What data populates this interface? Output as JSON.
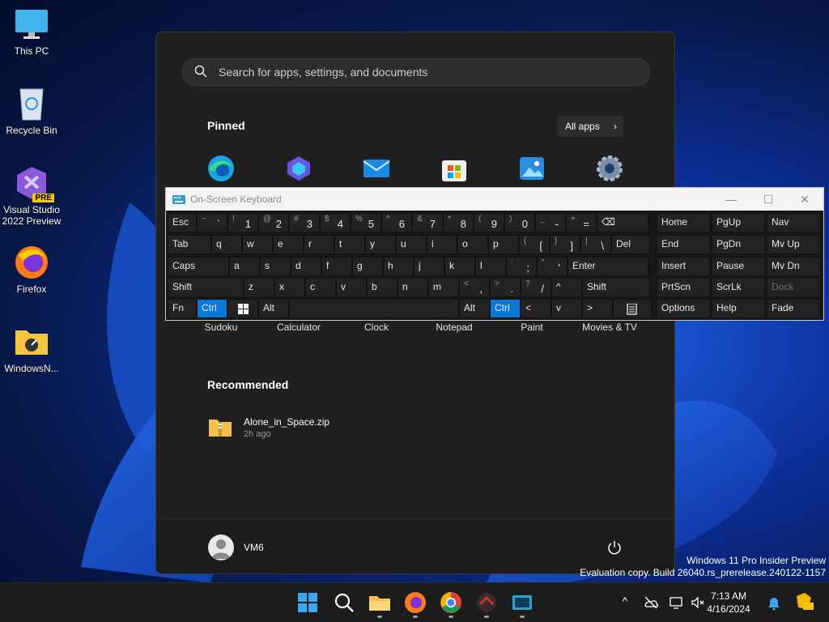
{
  "desktop": {
    "icons": [
      {
        "label": "This PC"
      },
      {
        "label": "Recycle Bin"
      },
      {
        "label": "Visual Studio 2022 Preview",
        "badge": "PRE"
      },
      {
        "label": "Firefox"
      },
      {
        "label": "WindowsN..."
      }
    ],
    "watermark": {
      "line1": "Windows 11 Pro Insider Preview",
      "line2": "Evaluation copy. Build 26040.rs_prerelease.240122-1157"
    }
  },
  "start_menu": {
    "search_placeholder": "Search for apps, settings, and documents",
    "pinned_title": "Pinned",
    "all_apps_label": "All apps",
    "all_apps_chevron": "›",
    "pinned_apps": [
      {
        "label": "",
        "icon": "edge-icon"
      },
      {
        "label": "",
        "icon": "copilot-icon"
      },
      {
        "label": "",
        "icon": "mail-icon"
      },
      {
        "label": "",
        "icon": "store-icon"
      },
      {
        "label": "",
        "icon": "photos-icon"
      },
      {
        "label": "",
        "icon": "settings-icon"
      },
      {
        "label": "Sudoku"
      },
      {
        "label": "Calculator"
      },
      {
        "label": "Clock"
      },
      {
        "label": "Notepad"
      },
      {
        "label": "Paint"
      },
      {
        "label": "Movies & TV"
      }
    ],
    "recommended_title": "Recommended",
    "recommended": [
      {
        "name": "Alone_in_Space.zip",
        "time": "2h ago"
      }
    ],
    "user": {
      "name": "VM6"
    }
  },
  "osk": {
    "title": "On-Screen Keyboard",
    "window_buttons": {
      "minimize": "—",
      "maximize": "☐",
      "close": "✕"
    },
    "rows": {
      "r1": [
        {
          "main": "Esc"
        },
        {
          "shift": "~",
          "main": "`"
        },
        {
          "shift": "!",
          "main": "1"
        },
        {
          "shift": "@",
          "main": "2"
        },
        {
          "shift": "#",
          "main": "3"
        },
        {
          "shift": "$",
          "main": "4"
        },
        {
          "shift": "%",
          "main": "5"
        },
        {
          "shift": "^",
          "main": "6"
        },
        {
          "shift": "&",
          "main": "7"
        },
        {
          "shift": "*",
          "main": "8"
        },
        {
          "shift": "(",
          "main": "9"
        },
        {
          "shift": ")",
          "main": "0"
        },
        {
          "shift": "_",
          "main": "-"
        },
        {
          "shift": "+",
          "main": "="
        },
        {
          "main": "⌫"
        }
      ],
      "r2": [
        {
          "main": "Tab"
        },
        {
          "main": "q"
        },
        {
          "main": "w"
        },
        {
          "main": "e"
        },
        {
          "main": "r"
        },
        {
          "main": "t"
        },
        {
          "main": "y"
        },
        {
          "main": "u"
        },
        {
          "main": "i"
        },
        {
          "main": "o"
        },
        {
          "main": "p"
        },
        {
          "shift": "{",
          "main": "["
        },
        {
          "shift": "}",
          "main": "]"
        },
        {
          "shift": "|",
          "main": "\\"
        },
        {
          "main": "Del"
        }
      ],
      "r3": [
        {
          "main": "Caps"
        },
        {
          "main": "a"
        },
        {
          "main": "s"
        },
        {
          "main": "d"
        },
        {
          "main": "f"
        },
        {
          "main": "g"
        },
        {
          "main": "h"
        },
        {
          "main": "j"
        },
        {
          "main": "k"
        },
        {
          "main": "l"
        },
        {
          "shift": ":",
          "main": ";"
        },
        {
          "shift": "\"",
          "main": "'"
        },
        {
          "main": "Enter"
        }
      ],
      "r4": [
        {
          "main": "Shift"
        },
        {
          "main": "z"
        },
        {
          "main": "x"
        },
        {
          "main": "c"
        },
        {
          "main": "v"
        },
        {
          "main": "b"
        },
        {
          "main": "n"
        },
        {
          "main": "m"
        },
        {
          "shift": "<",
          "main": ","
        },
        {
          "shift": ">",
          "main": "."
        },
        {
          "shift": "?",
          "main": "/"
        },
        {
          "main": "^"
        },
        {
          "main": "Shift"
        }
      ],
      "r5": [
        {
          "main": "Fn"
        },
        {
          "main": "Ctrl"
        },
        {
          "main": "",
          "icon": "windows-key-icon"
        },
        {
          "main": "Alt"
        },
        {
          "main": ""
        },
        {
          "main": "Alt"
        },
        {
          "main": "Ctrl"
        },
        {
          "main": "<"
        },
        {
          "main": "v"
        },
        {
          "main": ">"
        },
        {
          "main": "",
          "icon": "menu-key-icon"
        }
      ]
    },
    "nav_keys": [
      [
        "Home",
        "PgUp",
        "Nav"
      ],
      [
        "End",
        "PgDn",
        "Mv Up"
      ],
      [
        "Insert",
        "Pause",
        "Mv Dn"
      ],
      [
        "PrtScn",
        "ScrLk",
        "Dock"
      ],
      [
        "Options",
        "Help",
        "Fade"
      ]
    ]
  },
  "taskbar": {
    "apps": [
      "start-icon",
      "search-icon",
      "file-explorer-icon",
      "firefox-icon",
      "chrome-icon",
      "dark-app-icon",
      "terminal-app-icon"
    ],
    "clock_time": "7:13 AM",
    "clock_date": "4/16/2024",
    "tray_chevron": "^"
  },
  "colors": {
    "accent": "#0a78d4",
    "start_bg": "#202020",
    "osk_bg": "#171717"
  }
}
